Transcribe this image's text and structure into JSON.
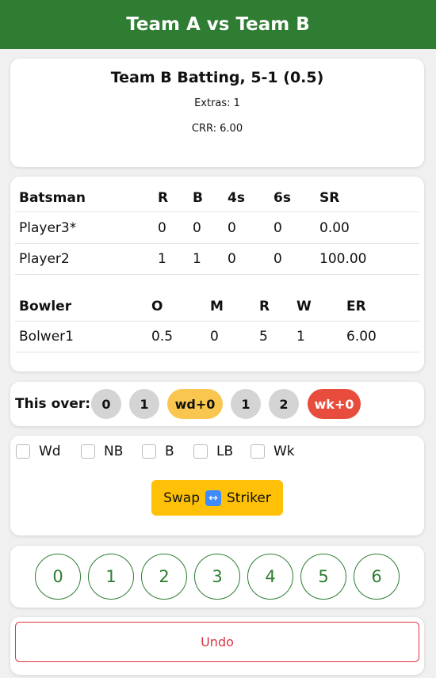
{
  "header": {
    "title": "Team A vs Team B"
  },
  "score": {
    "title": "Team B Batting, 5-1 (0.5)",
    "extras": "Extras: 1",
    "crr": "CRR: 6.00"
  },
  "batting": {
    "headers": [
      "Batsman",
      "R",
      "B",
      "4s",
      "6s",
      "SR"
    ],
    "rows": [
      [
        "Player3*",
        "0",
        "0",
        "0",
        "0",
        "0.00"
      ],
      [
        "Player2",
        "1",
        "1",
        "0",
        "0",
        "100.00"
      ]
    ]
  },
  "bowling": {
    "headers": [
      "Bowler",
      "O",
      "M",
      "R",
      "W",
      "ER"
    ],
    "rows": [
      [
        "Bolwer1",
        "0.5",
        "0",
        "5",
        "1",
        "6.00"
      ]
    ]
  },
  "this_over": {
    "label": "This over:",
    "balls": [
      "0",
      "1",
      "wd+0",
      "1",
      "2",
      "wk+0"
    ]
  },
  "extras": {
    "options": [
      "Wd",
      "NB",
      "B",
      "LB",
      "Wk"
    ],
    "swap_label_left": "Swap",
    "swap_label_right": "Striker",
    "swap_icon": "left-right-arrow-icon"
  },
  "runs": [
    "0",
    "1",
    "2",
    "3",
    "4",
    "5",
    "6"
  ],
  "undo": {
    "label": "Undo"
  },
  "colors": {
    "header": "#2e7d32",
    "ball": "#d4d4d4",
    "wide": "#f9c74f",
    "wicket": "#e74c3c",
    "swap": "#ffc107",
    "undo": "#dc3545"
  }
}
